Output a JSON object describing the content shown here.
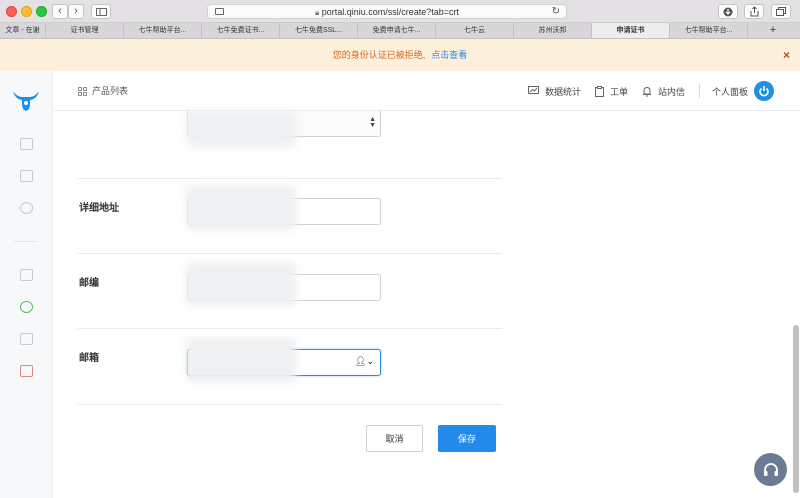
{
  "browser": {
    "url": "portal.qiniu.com/ssl/create?tab=crt",
    "tabs": [
      {
        "label": "文章 - 在谢",
        "active": false
      },
      {
        "label": "证书管理",
        "active": false
      },
      {
        "label": "七牛帮助平台...",
        "active": false
      },
      {
        "label": "七牛免费证书...",
        "active": false
      },
      {
        "label": "七牛免费SSL...",
        "active": false
      },
      {
        "label": "免费申请七牛...",
        "active": false
      },
      {
        "label": "七牛云",
        "active": false
      },
      {
        "label": "苏州沃邦",
        "active": false
      },
      {
        "label": "申请证书",
        "active": true
      },
      {
        "label": "七牛帮助平台...",
        "active": false
      }
    ]
  },
  "notice": {
    "message": "您的身份认证已被拒绝,",
    "link": "点击查看",
    "close_icon": "×"
  },
  "nav": {
    "products": "产品列表",
    "stats": "数据统计",
    "ticket": "工单",
    "messages": "站内信",
    "panel": "个人面板"
  },
  "form": {
    "address_label": "详细地址",
    "postcode_label": "邮编",
    "email_label": "邮箱"
  },
  "buttons": {
    "cancel": "取消",
    "save": "保存"
  },
  "colors": {
    "accent": "#2389ea",
    "notice_bg": "#fcefdc",
    "notice_text": "#d9671f"
  }
}
